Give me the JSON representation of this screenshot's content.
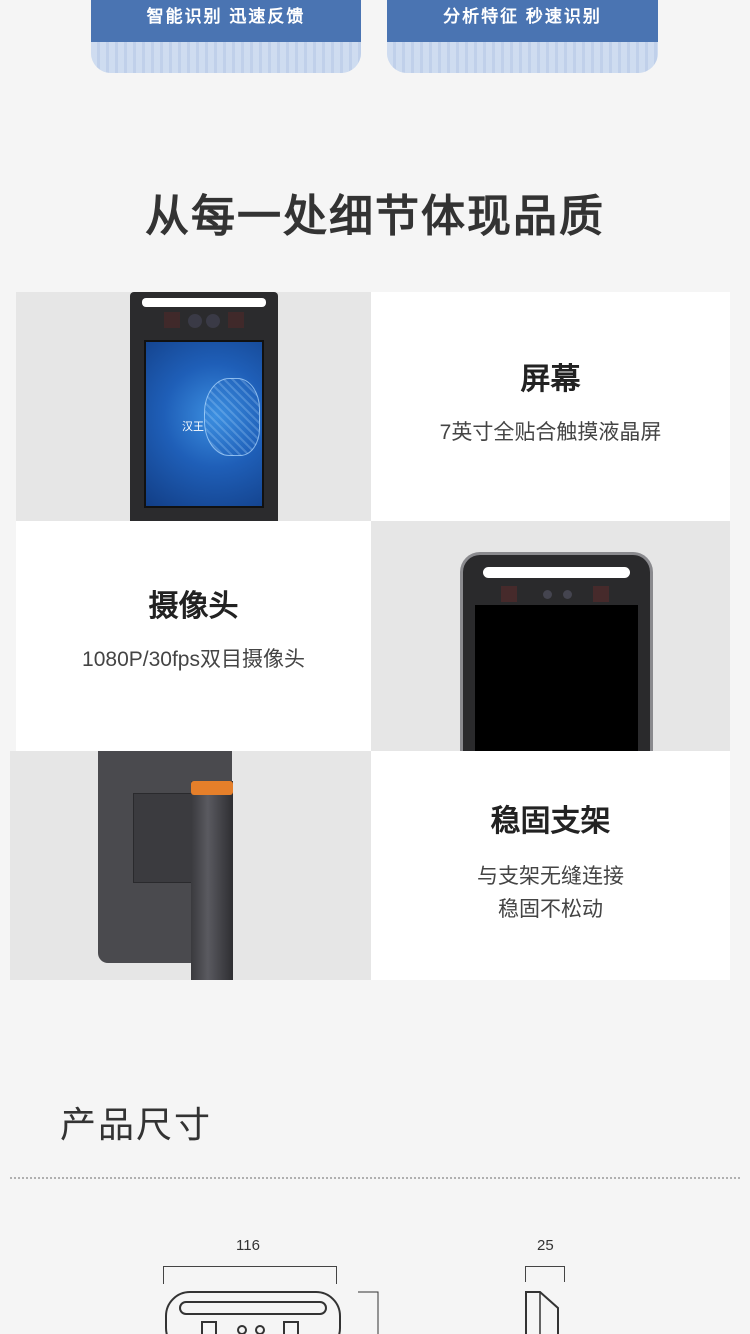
{
  "banners": [
    {
      "text": "智能识别 迅速反馈"
    },
    {
      "text": "分析特征 秒速识别"
    }
  ],
  "section_title": "从每一处细节体现品质",
  "features": {
    "screen": {
      "title": "屏幕",
      "desc": "7英寸全贴合触摸液晶屏"
    },
    "camera": {
      "title": "摄像头",
      "desc": "1080P/30fps双目摄像头"
    },
    "bracket": {
      "title": "稳固支架",
      "desc_line1": "与支架无缝连接",
      "desc_line2": "稳固不松动"
    }
  },
  "device_logo": "汉王",
  "dimensions": {
    "title": "产品尺寸",
    "width": "116",
    "depth": "25"
  }
}
